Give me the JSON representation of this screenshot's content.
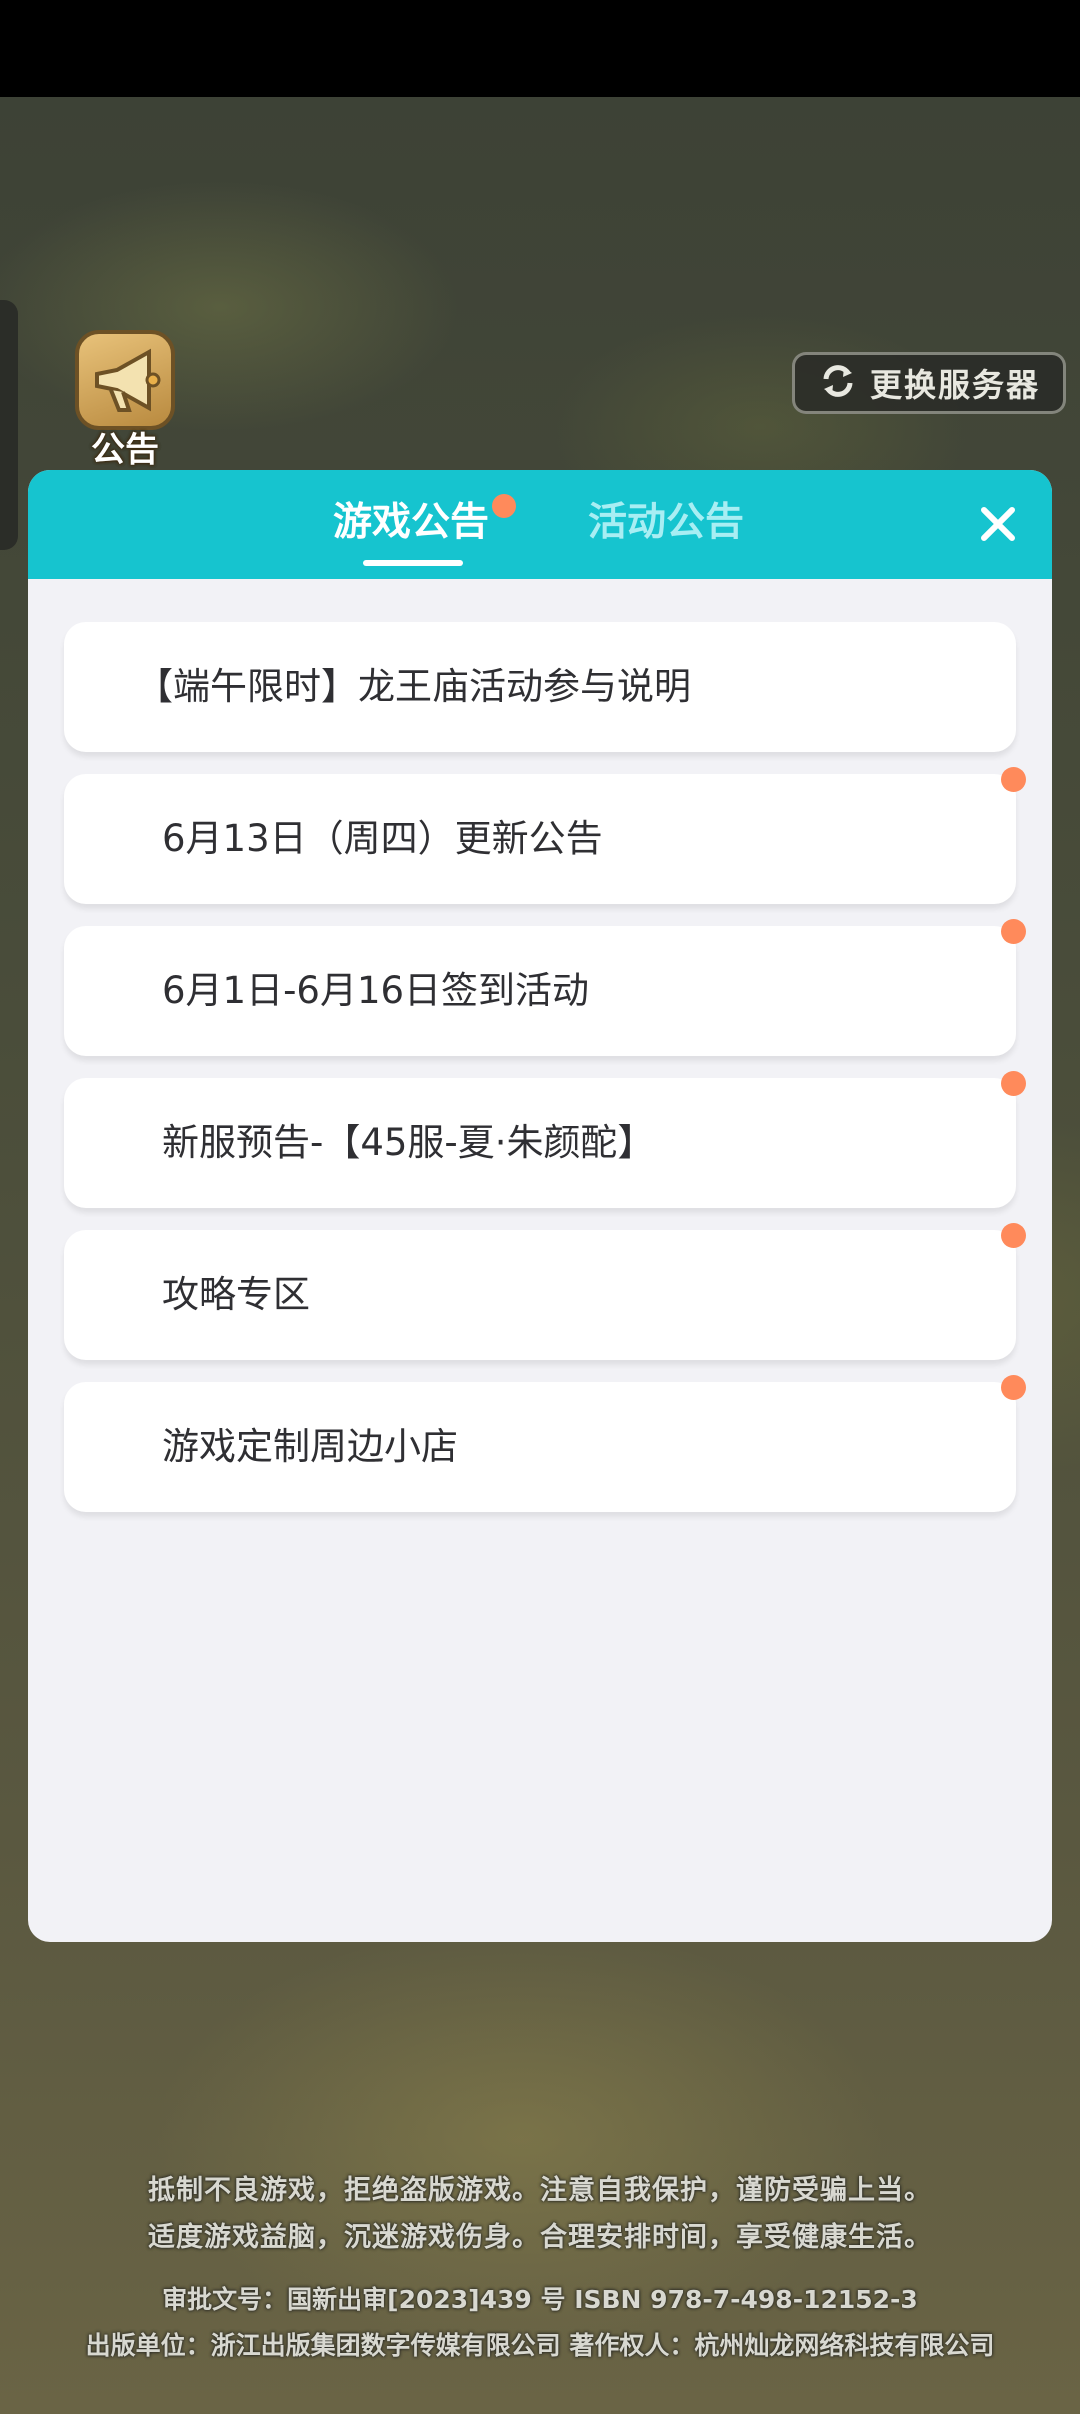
{
  "hud": {
    "notice_label": "公告",
    "server_switch_label": "更换服务器"
  },
  "modal": {
    "tabs": [
      {
        "label": "游戏公告",
        "active": true,
        "has_unread": true
      },
      {
        "label": "活动公告",
        "active": false,
        "has_unread": false
      }
    ],
    "close_icon": "close-icon",
    "items": [
      {
        "title": "【端午限时】龙王庙活动参与说明",
        "unread": false
      },
      {
        "title": "6月13日（周四）更新公告",
        "unread": true
      },
      {
        "title": "6月1日-6月16日签到活动",
        "unread": true
      },
      {
        "title": "新服预告-【45服-夏·朱颜酡】",
        "unread": true
      },
      {
        "title": "攻略专区",
        "unread": true
      },
      {
        "title": "游戏定制周边小店",
        "unread": true
      }
    ]
  },
  "footer": {
    "line1": "抵制不良游戏，拒绝盗版游戏。注意自我保护，谨防受骗上当。",
    "line2": "适度游戏益脑，沉迷游戏伤身。合理安排时间，享受健康生活。",
    "line3": "审批文号：国新出审[2023]439 号  ISBN 978-7-498-12152-3",
    "line4": "出版单位：浙江出版集团数字传媒有限公司  著作权人：杭州灿龙网络科技有限公司"
  },
  "colors": {
    "header_teal": "#16c4cf",
    "unread_dot": "#ff8a5b",
    "modal_bg": "#f2f2f6",
    "item_text": "#2f2f33"
  }
}
